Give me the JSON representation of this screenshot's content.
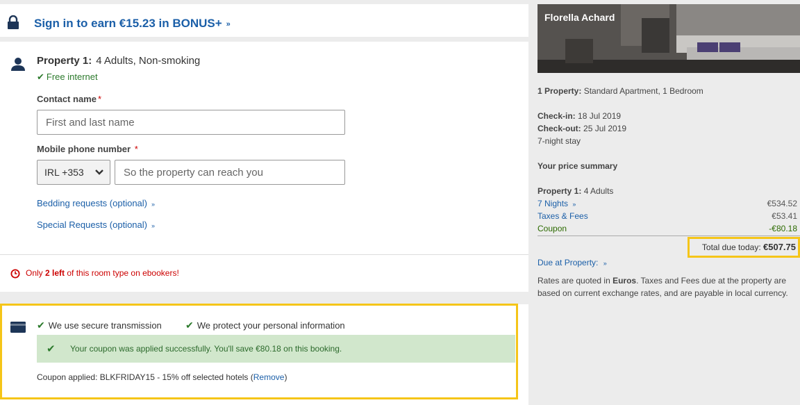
{
  "signin": {
    "text": "Sign in to earn €15.23 in BONUS+",
    "chevron": "»"
  },
  "property": {
    "label": "Property 1:",
    "details": "4 Adults, Non-smoking",
    "amenity": "Free internet",
    "contact_label": "Contact name",
    "contact_required": "*",
    "contact_placeholder": "First and last name",
    "phone_label": "Mobile phone number",
    "phone_required": "*",
    "country_code": "IRL +353",
    "phone_placeholder": "So the property can reach you",
    "bedding_link": "Bedding requests (optional)",
    "special_link": "Special Requests (optional)"
  },
  "scarcity": {
    "prefix": "Only ",
    "count": "2 left",
    "suffix": " of this room type on ebookers!"
  },
  "payment": {
    "secure_transmission": "We use secure transmission",
    "protect_info": "We protect your personal information",
    "success_message": "Your coupon was applied successfully. You'll save €80.18 on this booking.",
    "coupon_prefix": "Coupon applied: BLKFRIDAY15 - 15% off selected hotels (",
    "remove_link": "Remove",
    "coupon_suffix": ")"
  },
  "summary": {
    "hotel_name": "Florella Achard",
    "room_label": "1 Property:",
    "room_type": "Standard Apartment, 1 Bedroom",
    "checkin_label": "Check-in:",
    "checkin_date": "18 Jul 2019",
    "checkout_label": "Check-out:",
    "checkout_date": "25 Jul 2019",
    "stay_length": "7-night stay",
    "price_summary_title": "Your price summary",
    "property_label": "Property 1:",
    "property_guests": "4 Adults",
    "nights_label": "7 Nights",
    "nights_amount": "€534.52",
    "taxes_label": "Taxes & Fees",
    "taxes_amount": "€53.41",
    "coupon_label": "Coupon",
    "coupon_amount": "-€80.18",
    "total_label": "Total due today:",
    "total_amount": "€507.75",
    "due_at_property": "Due at Property:",
    "rates_prefix": "Rates are quoted in ",
    "rates_currency": "Euros",
    "rates_suffix": ". Taxes and Fees due at the property are based on current exchange rates, and are payable in local currency."
  },
  "colors": {
    "link_blue": "#1b5fa8",
    "success_green": "#2c7a2c",
    "highlight_yellow": "#f5c518",
    "alert_red": "#cc0000"
  }
}
